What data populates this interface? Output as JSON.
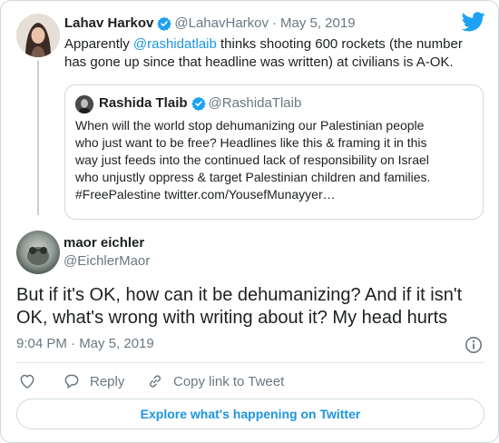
{
  "colors": {
    "brand": "#1da1f2",
    "link": "#1b95e0",
    "text": "#1c2022",
    "secondary": "#697882",
    "border": "#cfd9de"
  },
  "parent_tweet": {
    "author_name": "Lahav Harkov",
    "author_handle": "@LahavHarkov",
    "separator": "·",
    "date": "May 5, 2019",
    "verified": true,
    "text_before": "Apparently ",
    "mention": "@rashidatlaib",
    "text_after": " thinks shooting 600 rockets (the number has gone up since that headline was written) at civilians is A-OK."
  },
  "quoted_tweet": {
    "author_name": "Rashida Tlaib",
    "author_handle": "@RashidaTlaib",
    "verified": true,
    "lines": [
      "When will the world stop dehumanizing our Palestinian people",
      "who just want to be free? Headlines like this & framing it in this",
      "way just feeds into the continued lack of responsibility on Israel",
      "who unjustly oppress & target Palestinian children and families.",
      "#FreePalestine twitter.com/YousefMunayyer…"
    ]
  },
  "main_tweet": {
    "author_name": "maor eichler",
    "author_handle": "@EichlerMaor",
    "lines": [
      "But if it's OK, how can it be dehumanizing? And if it isn't",
      "OK, what's wrong with writing about it? My head hurts"
    ],
    "timestamp": "9:04 PM · May 5, 2019"
  },
  "actions": {
    "like_icon": "heart-icon",
    "reply_label": "Reply",
    "reply_icon": "reply-icon",
    "copy_label": "Copy link to Tweet",
    "copy_icon": "link-icon",
    "info_icon": "info-icon"
  },
  "explore_label": "Explore what's happening on Twitter"
}
